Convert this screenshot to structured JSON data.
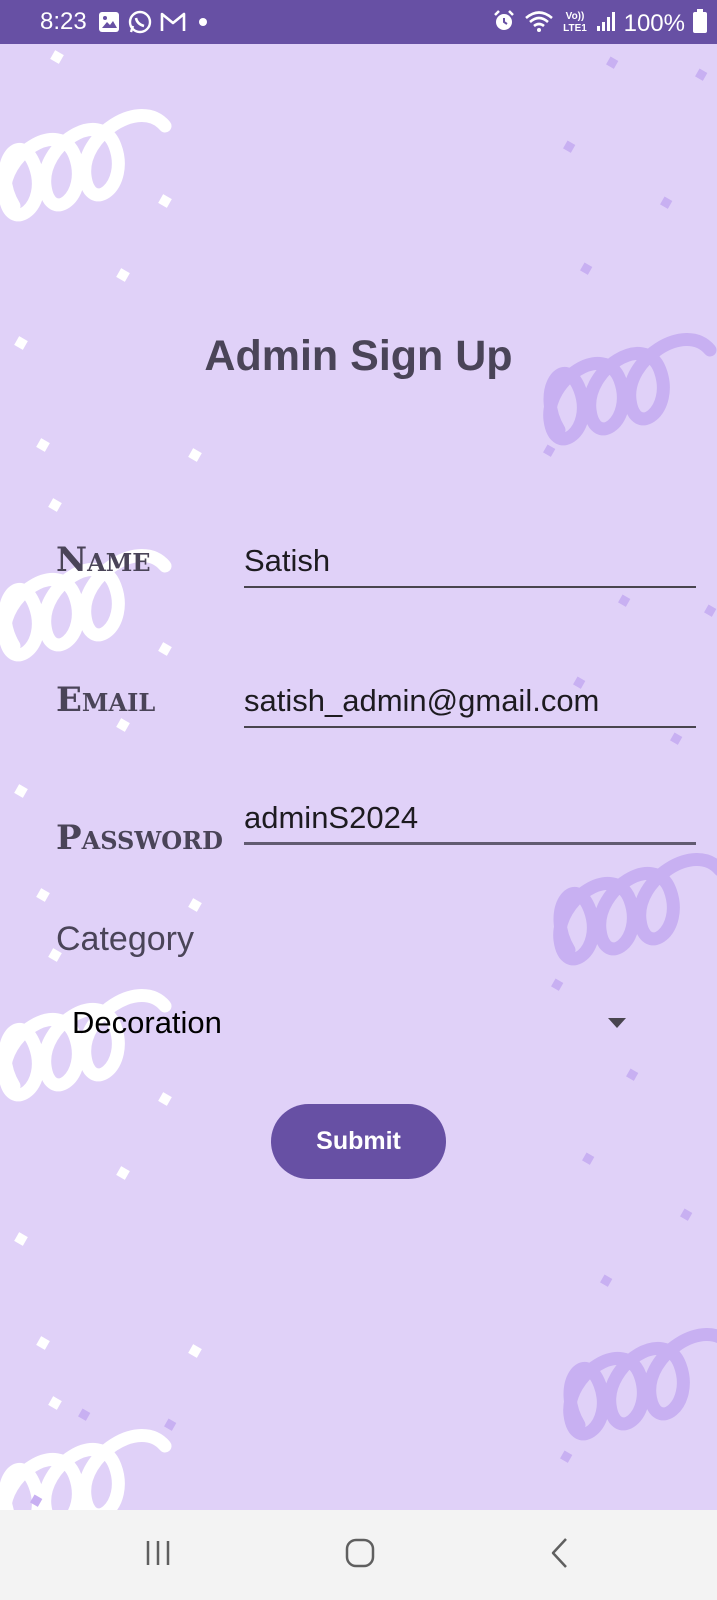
{
  "status_bar": {
    "time": "8:23",
    "battery_percent": "100%",
    "left_icons": [
      "gallery-icon",
      "whatsapp-icon",
      "gmail-icon",
      "dot-icon"
    ],
    "right_icons": [
      "alarm-icon",
      "wifi-icon",
      "volte-icon",
      "signal-icon",
      "battery-icon"
    ],
    "volte_label": "Vo)) LTE1",
    "bar_color": "#6750a4"
  },
  "page": {
    "title": "Admin Sign Up",
    "background_color": "#e0d1f8"
  },
  "form": {
    "name": {
      "label": "Name",
      "value": "Satish"
    },
    "email": {
      "label": "Email",
      "value": "satish_admin@gmail.com"
    },
    "password": {
      "label": "Password",
      "value": "adminS2024"
    },
    "category": {
      "label": "Category",
      "selected": "Decoration"
    },
    "submit_label": "Submit",
    "accent_color": "#6750a4"
  },
  "nav_bar": {
    "buttons": [
      "recent-apps-icon",
      "home-icon",
      "back-icon"
    ]
  }
}
